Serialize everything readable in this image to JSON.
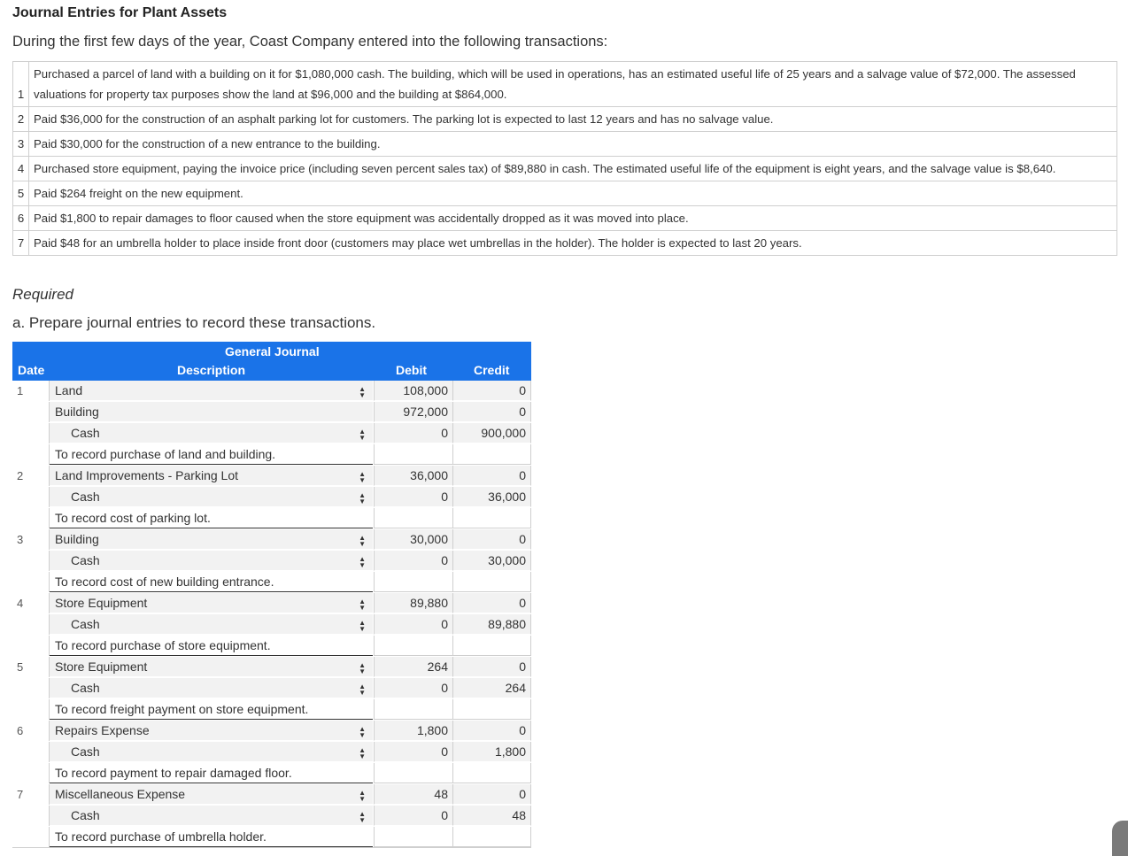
{
  "title": "Journal Entries for Plant Assets",
  "intro": "During the first few days of the year, Coast Company entered into the following transactions:",
  "transactions": [
    {
      "num": "1",
      "text": "Purchased a parcel of land with a building on it for $1,080,000 cash. The building, which will be used in operations, has an estimated useful life of 25 years and a salvage value of $72,000. The assessed valuations for property tax purposes show the land at $96,000 and the building at $864,000."
    },
    {
      "num": "2",
      "text": "Paid $36,000 for the construction of an asphalt parking lot for customers. The parking lot is expected to last 12 years and has no salvage value."
    },
    {
      "num": "3",
      "text": "Paid $30,000 for the construction of a new entrance to the building."
    },
    {
      "num": "4",
      "text": "Purchased store equipment, paying the invoice price (including seven percent sales tax) of $89,880 in cash. The estimated useful life of the equipment is eight years, and the salvage value is $8,640."
    },
    {
      "num": "5",
      "text": "Paid $264 freight on the new equipment."
    },
    {
      "num": "6",
      "text": "Paid $1,800 to repair damages to floor caused when the store equipment was accidentally dropped as it was moved into place."
    },
    {
      "num": "7",
      "text": "Paid $48 for an umbrella holder to place inside front door (customers may place wet umbrellas in the holder). The holder is expected to last 20 years."
    }
  ],
  "required": "Required",
  "question": "a. Prepare journal entries to record these transactions.",
  "journal": {
    "title": "General Journal",
    "headers": {
      "date": "Date",
      "description": "Description",
      "debit": "Debit",
      "credit": "Credit"
    },
    "select_icon": "updown-arrow-icon",
    "rows": [
      {
        "date": "1",
        "desc": "Land",
        "debit": "108,000",
        "credit": "0",
        "type": "debit",
        "select": true
      },
      {
        "date": "",
        "desc": "Building",
        "debit": "972,000",
        "credit": "0",
        "type": "debit",
        "select": false
      },
      {
        "date": "",
        "desc": "Cash",
        "debit": "0",
        "credit": "900,000",
        "type": "credit",
        "select": true
      },
      {
        "date": "",
        "desc": "To record purchase of land and building.",
        "debit": "",
        "credit": "",
        "type": "memo",
        "select": false
      },
      {
        "date": "2",
        "desc": "Land Improvements - Parking Lot",
        "debit": "36,000",
        "credit": "0",
        "type": "debit",
        "select": true
      },
      {
        "date": "",
        "desc": "Cash",
        "debit": "0",
        "credit": "36,000",
        "type": "credit",
        "select": true
      },
      {
        "date": "",
        "desc": "To record cost of parking lot.",
        "debit": "",
        "credit": "",
        "type": "memo",
        "select": false
      },
      {
        "date": "3",
        "desc": "Building",
        "debit": "30,000",
        "credit": "0",
        "type": "debit",
        "select": true
      },
      {
        "date": "",
        "desc": "Cash",
        "debit": "0",
        "credit": "30,000",
        "type": "credit",
        "select": true
      },
      {
        "date": "",
        "desc": "To record cost of new building entrance.",
        "debit": "",
        "credit": "",
        "type": "memo",
        "select": false
      },
      {
        "date": "4",
        "desc": "Store Equipment",
        "debit": "89,880",
        "credit": "0",
        "type": "debit",
        "select": true
      },
      {
        "date": "",
        "desc": "Cash",
        "debit": "0",
        "credit": "89,880",
        "type": "credit",
        "select": true
      },
      {
        "date": "",
        "desc": "To record purchase of store equipment.",
        "debit": "",
        "credit": "",
        "type": "memo",
        "select": false
      },
      {
        "date": "5",
        "desc": "Store Equipment",
        "debit": "264",
        "credit": "0",
        "type": "debit",
        "select": true
      },
      {
        "date": "",
        "desc": "Cash",
        "debit": "0",
        "credit": "264",
        "type": "credit",
        "select": true
      },
      {
        "date": "",
        "desc": "To record freight payment on store equipment.",
        "debit": "",
        "credit": "",
        "type": "memo",
        "select": false
      },
      {
        "date": "6",
        "desc": "Repairs Expense",
        "debit": "1,800",
        "credit": "0",
        "type": "debit",
        "select": true
      },
      {
        "date": "",
        "desc": "Cash",
        "debit": "0",
        "credit": "1,800",
        "type": "credit",
        "select": true
      },
      {
        "date": "",
        "desc": "To record payment to repair damaged floor.",
        "debit": "",
        "credit": "",
        "type": "memo",
        "select": false
      },
      {
        "date": "7",
        "desc": "Miscellaneous Expense",
        "debit": "48",
        "credit": "0",
        "type": "debit",
        "select": true
      },
      {
        "date": "",
        "desc": "Cash",
        "debit": "0",
        "credit": "48",
        "type": "credit",
        "select": true
      },
      {
        "date": "",
        "desc": "To record purchase of umbrella holder.",
        "debit": "",
        "credit": "",
        "type": "memo",
        "select": false
      }
    ]
  }
}
